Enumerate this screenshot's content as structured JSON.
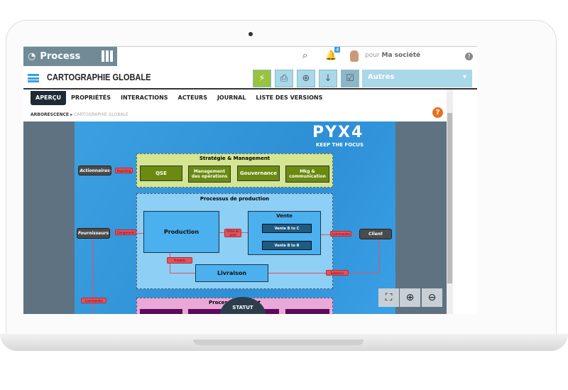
{
  "app": {
    "name": "Process",
    "user_prefix": "pour",
    "company": "Ma société",
    "notifications": "4"
  },
  "header": {
    "title": "CARTOGRAPHIE GLOBALE",
    "dropdown": "Autres"
  },
  "tabs": [
    "APERÇU",
    "PROPRIÉTÉS",
    "INTERACTIONS",
    "ACTEURS",
    "JOURNAL",
    "LISTE DES VERSIONS"
  ],
  "breadcrumb": {
    "root": "ARBORESCENCE",
    "current": "CARTOGRAPHIE GLOBALE"
  },
  "map": {
    "logo": "PYX4",
    "tagline": "KEEP THE FOCUS",
    "strategy": {
      "title": "Stratégie & Management",
      "items": [
        "QSE",
        "Management des opérations",
        "Gouvernance",
        "Mkg & communication"
      ]
    },
    "production": {
      "title": "Processus de production",
      "production": "Production",
      "vente": "Vente",
      "vente_items": [
        "Vente B to C",
        "Vente B to B"
      ],
      "livraison": "Livraison"
    },
    "support": {
      "title": "Processus support"
    },
    "actors": {
      "actionnaires": "Actionnaires",
      "fournisseurs": "Fournisseurs",
      "client": "Client"
    },
    "flows": {
      "reporting": "Reporting",
      "composants": "Composants",
      "ordre": "Ordre de prod",
      "produits": "Produits",
      "commandes_client": "Commandes",
      "solutions": "Solutions",
      "commandes_fourn": "Commandes"
    },
    "statut": "STATUT"
  },
  "colors": {
    "accent": "#3aa0dd",
    "brand_bar": "#708a96",
    "map_bg": "#2d8fd5",
    "strategy": "#6a8a10",
    "help": "#e87020"
  }
}
